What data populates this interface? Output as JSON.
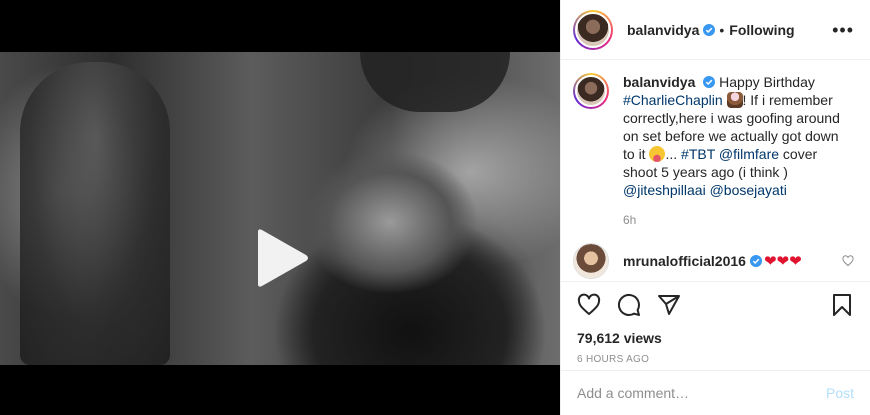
{
  "post": {
    "author": "balanvidya",
    "follow_status": "Following",
    "more_icon": "more-options-icon",
    "caption": {
      "author": "balanvidya",
      "part1": "Happy Birthday",
      "tag_charlie": "#CharlieChaplin",
      "part2": "! If i remember correctly,here i was goofing around on set before we actually got down to it",
      "part3": "...",
      "tag_tbt": "#TBT",
      "mention_filmfare": "@filmfare",
      "part4": "cover shoot 5 years ago (i think )",
      "mention_jitesh": "@jiteshpillaai",
      "mention_bose": "@bosejayati",
      "time": "6h"
    },
    "comments": [
      {
        "user": "mrunalofficial2016",
        "text": "❤❤❤"
      }
    ],
    "views": "79,612 views",
    "age": "6 HOURS AGO",
    "add_comment_placeholder": "Add a comment…",
    "post_label": "Post"
  },
  "colors": {
    "link": "#00376b",
    "verified": "#3897f0",
    "post_button_disabled": "#b2dffc",
    "heart": "#e0142e"
  }
}
